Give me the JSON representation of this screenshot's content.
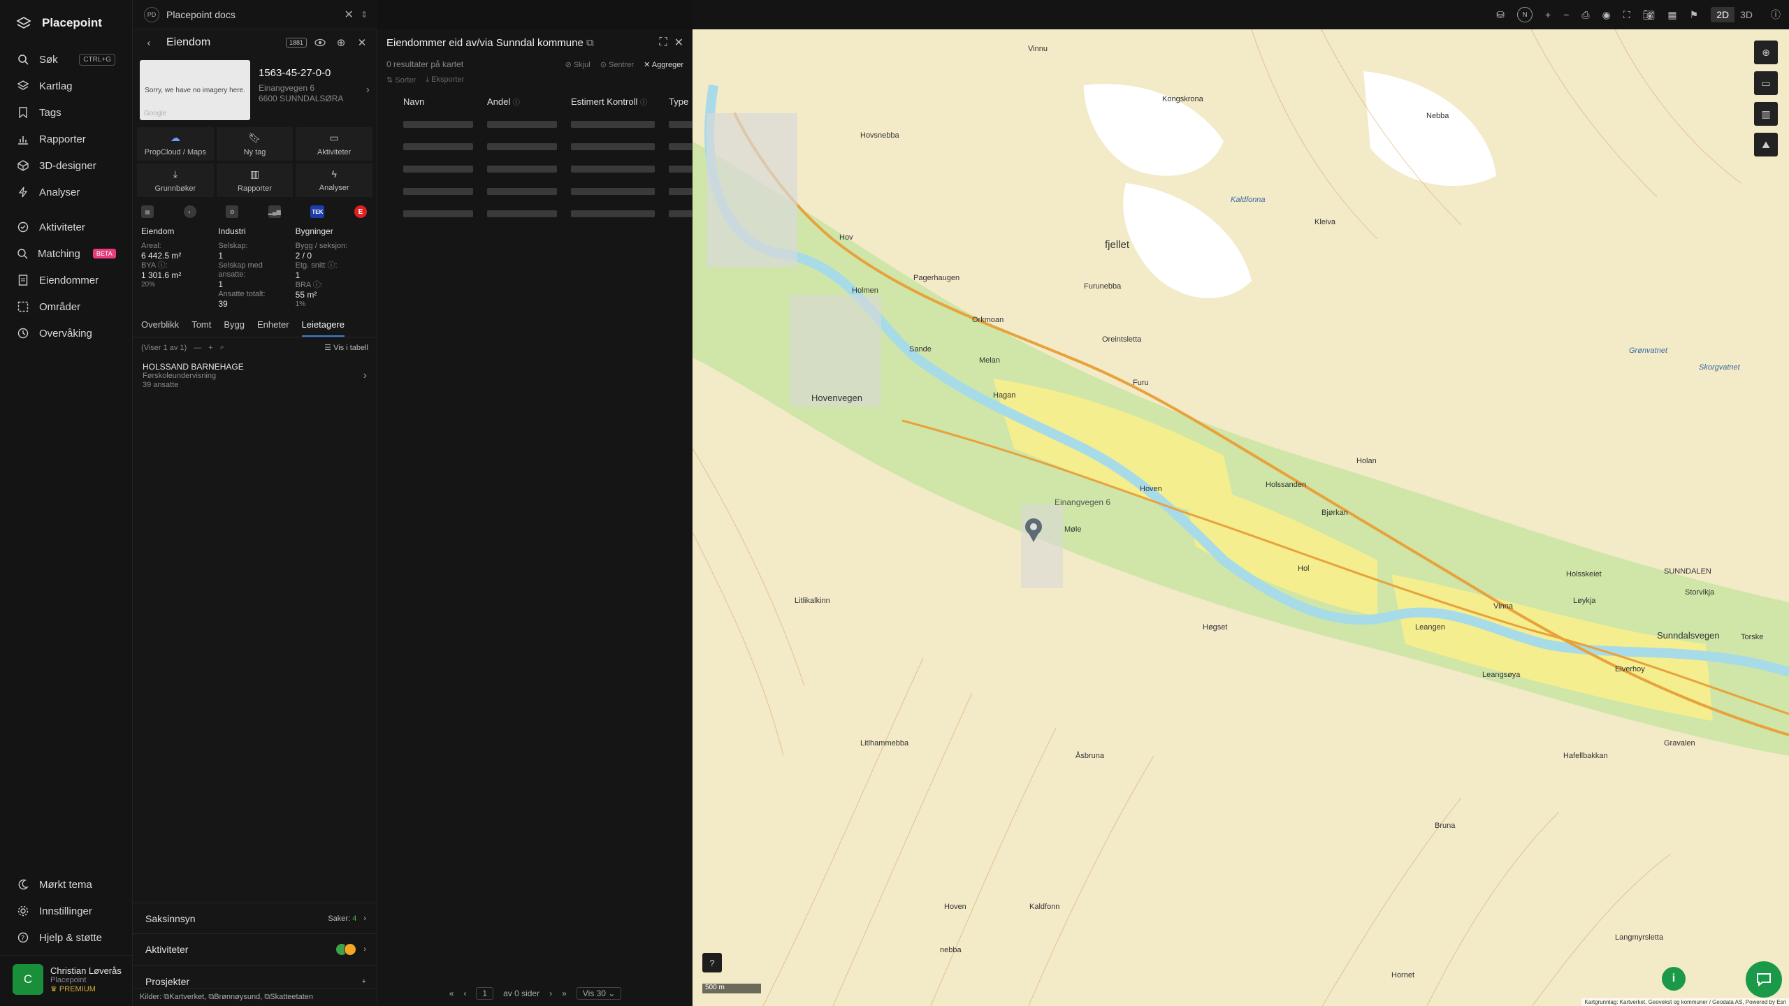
{
  "app": {
    "name": "Placepoint"
  },
  "nav": {
    "items": [
      {
        "label": "Søk",
        "shortcut": "CTRL+G"
      },
      {
        "label": "Kartlag"
      },
      {
        "label": "Tags"
      },
      {
        "label": "Rapporter"
      },
      {
        "label": "3D-designer"
      },
      {
        "label": "Analyser"
      }
    ],
    "items2": [
      {
        "label": "Aktiviteter"
      },
      {
        "label": "Matching",
        "badge": "BETA"
      },
      {
        "label": "Eiendommer"
      },
      {
        "label": "Områder"
      },
      {
        "label": "Overvåking"
      }
    ],
    "bottom": [
      {
        "label": "Mørkt tema"
      },
      {
        "label": "Innstillinger"
      },
      {
        "label": "Hjelp & støtte"
      }
    ],
    "user": {
      "initial": "C",
      "name": "Christian Løverås",
      "org": "Placepoint",
      "plan": "PREMIUM"
    }
  },
  "docs": {
    "badge": "PD",
    "title": "Placepoint docs"
  },
  "property": {
    "header": "Eiendom",
    "pill": "1881",
    "thumb_text": "Sorry, we have no imagery here.",
    "thumb_brand": "Google",
    "id": "1563-45-27-0-0",
    "address1": "Einangvegen 6",
    "address2": "6600 SUNNDALSØRA",
    "actions": [
      {
        "label": "PropCloud / Maps"
      },
      {
        "label": "Ny tag"
      },
      {
        "label": "Aktiviteter"
      },
      {
        "label": "Grunnbøker"
      },
      {
        "label": "Rapporter"
      },
      {
        "label": "Analyser"
      }
    ],
    "sources": {
      "tek": "TEK",
      "e": "E"
    },
    "stats": {
      "eiendom": {
        "h": "Eiendom",
        "areal_l": "Areal:",
        "areal_v": "6 442.5 m²",
        "bya_l": "BYA ⓘ:",
        "bya_v": "1 301.6 m²",
        "bya_p": "20%"
      },
      "industri": {
        "h": "Industri",
        "selskap_l": "Selskap:",
        "selskap_v": "1",
        "ansatte_l": "Selskap med ansatte:",
        "ansatte_v": "1",
        "tot_l": "Ansatte totalt:",
        "tot_v": "39"
      },
      "bygninger": {
        "h": "Bygninger",
        "bs_l": "Bygg / seksjon:",
        "bs_v": "2 / 0",
        "etg_l": "Etg. snitt ⓘ:",
        "etg_v": "1",
        "bra_l": "BRA ⓘ:",
        "bra_v": "55 m²",
        "bra_p": "1%"
      }
    },
    "tabs": [
      "Overblikk",
      "Tomt",
      "Bygg",
      "Enheter",
      "Leietagere"
    ],
    "active_tab": "Leietagere",
    "list_info": "(Viser 1 av 1)",
    "table_view": "Vis i tabell",
    "tenant": {
      "name": "HOLSSAND BARNEHAGE",
      "type": "Førskoleundervisning",
      "employees": "39 ansatte"
    },
    "saksinnsyn": {
      "label": "Saksinnsyn",
      "count_label": "Saker:",
      "count": "4"
    },
    "aktiviteter": {
      "label": "Aktiviteter"
    },
    "prosjekter": {
      "label": "Prosjekter"
    },
    "sources_line": {
      "prefix": "Kilder:",
      "s1": "Kartverket,",
      "s2": "Brønnøysund,",
      "s3": "Skatteetaten"
    }
  },
  "results": {
    "title": "Eiendommer eid av/via Sunndal kommune",
    "count": "0 resultater på kartet",
    "actions": [
      "Skjul",
      "Sentrer",
      "Aggreger"
    ],
    "tools": [
      "Sorter",
      "Eksporter"
    ],
    "columns": [
      "Navn",
      "Andel",
      "Estimert Kontroll",
      "Type"
    ],
    "pager": {
      "page": "1",
      "of": "av 0 sider",
      "per_page": "Vis 30"
    }
  },
  "map": {
    "scale": "500 m",
    "attribution": "Kartgrunnlag: Kartverket, Geovekst og kommuner / Geodata AS, Powered by Esri",
    "labels": [
      "Vinnu",
      "Hovsnebba",
      "Kongskrona",
      "Nebba",
      "fjellet",
      "Kaldfonna",
      "Kleiva",
      "Furunebba",
      "Grønvatnet",
      "Skorgvatnet",
      "Hov",
      "Pagerhaugen",
      "Holmen",
      "Sande",
      "Orkmoan",
      "Melan",
      "Hagan",
      "Furu",
      "Oreintsletta",
      "Hovenvegen",
      "Sunndalsvegen",
      "Holssanden",
      "Bjørkan",
      "Holan",
      "Hoven",
      "Hol",
      "Møle",
      "Einangvegen 6",
      "Litlikalkinn",
      "Høgset",
      "Leangen",
      "Vinna",
      "Holsskeiet",
      "SUNNDALEN",
      "Løykja",
      "Storvikja",
      "Torske",
      "Leangsøya",
      "Elverhoy",
      "Gravalen",
      "Hafellbakkan",
      "Litlhammebba",
      "Åsbruna",
      "Bruna",
      "Hoven",
      "Kaldfonn",
      "nebba",
      "Hornet",
      "Langmyrsletta"
    ],
    "colors": {
      "land": "#f3eac8",
      "forest": "#cfe6a8",
      "farmland": "#f4ee8f",
      "river": "#a8dbe8",
      "road": "#e8a23b",
      "glacier": "#ffffff",
      "contour": "#d6a25f"
    }
  },
  "topbar": {
    "north": "N",
    "plus": "+",
    "minus": "−",
    "mode2d": "2D",
    "mode3d": "3D"
  }
}
